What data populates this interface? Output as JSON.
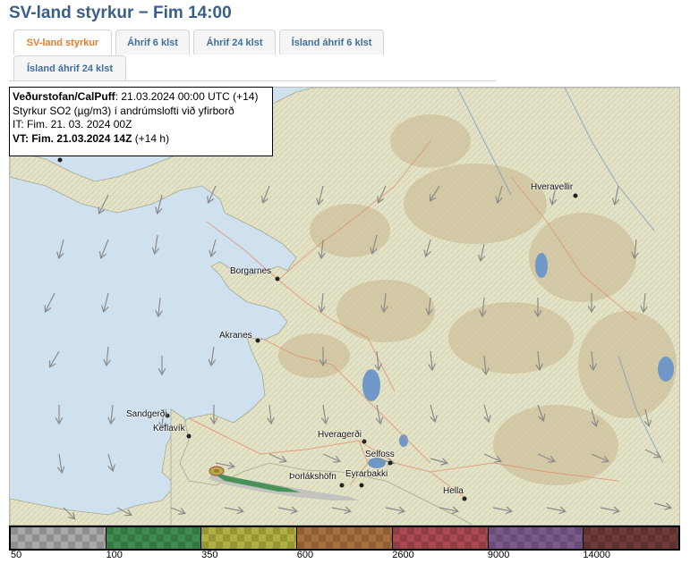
{
  "header": {
    "title": "SV-land styrkur − Fim 14:00"
  },
  "tabs": [
    {
      "label": "SV-land styrkur",
      "active": true
    },
    {
      "label": "Áhrif 6 klst",
      "active": false
    },
    {
      "label": "Áhrif 24 klst",
      "active": false
    },
    {
      "label": "Ísland áhrif 6 klst",
      "active": false
    },
    {
      "label": "Ísland áhrif 24 klst",
      "active": false
    }
  ],
  "info": {
    "source_label": "Veðurstofan/CalPuff",
    "source_value": ": 21.03.2024 00:00 UTC (+14)",
    "line2": "Styrkur SO2 (µg/m3) í andrúmslofti við yfirborð",
    "line3": "IT: Fim. 21. 03. 2024 00Z",
    "vt_label": "VT: Fim. 21.03.2024 14Z",
    "vt_value": " (+14 h)"
  },
  "places": [
    {
      "name": "Hveravellir"
    },
    {
      "name": "Borgarnes"
    },
    {
      "name": "Akranes"
    },
    {
      "name": "Sandgerði"
    },
    {
      "name": "Keflavík"
    },
    {
      "name": "Hveragerði"
    },
    {
      "name": "Selfoss"
    },
    {
      "name": "Þorlákshöfn"
    },
    {
      "name": "Eyrarbakki"
    },
    {
      "name": "Hella"
    }
  ],
  "legend": {
    "colors": [
      "#a8a8a8",
      "#3d8c4e",
      "#b0b040",
      "#a8703c",
      "#a84a50",
      "#7a5a8c",
      "#6e3a3a"
    ],
    "labels": [
      "50",
      "100",
      "350",
      "600",
      "2600",
      "9000",
      "14000"
    ]
  }
}
